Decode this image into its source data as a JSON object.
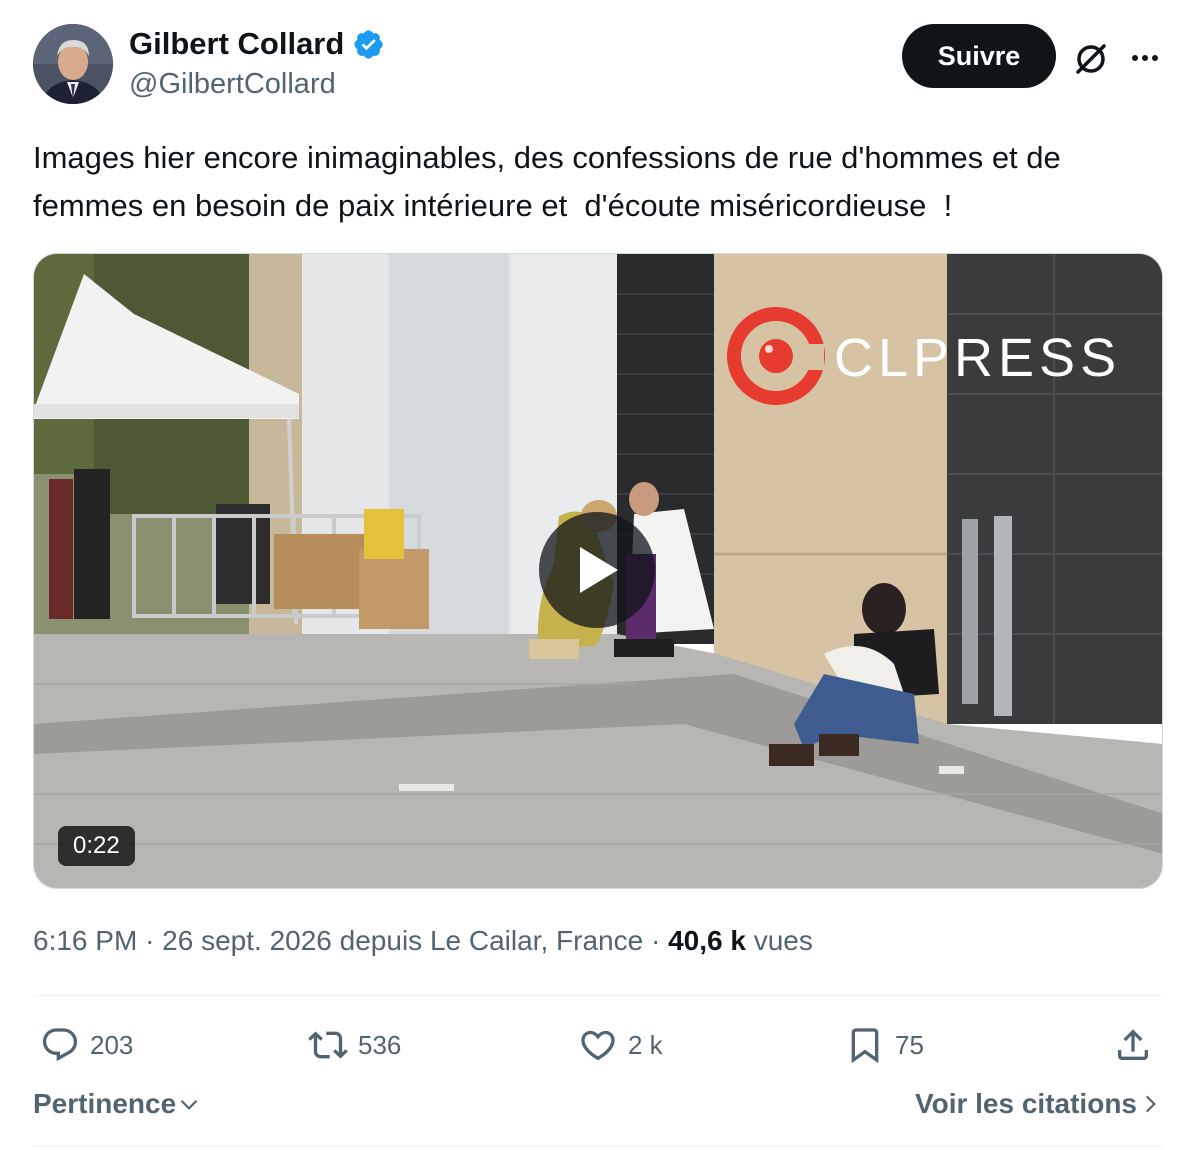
{
  "author": {
    "name": "Gilbert Collard",
    "handle": "@GilbertCollard",
    "verified": true
  },
  "header": {
    "follow_label": "Suivre",
    "icons": [
      "grok-icon",
      "more-icon"
    ]
  },
  "tweet": {
    "text": "Images hier encore inimaginables, des confessions de rue d'hommes et de femmes en besoin de paix intérieure et  d'écoute miséricordieuse  !"
  },
  "media": {
    "type": "video",
    "duration": "0:22",
    "watermark": "CLPRESS"
  },
  "meta": {
    "time": "6:16 PM",
    "separator": "·",
    "date": "26 sept. 2026",
    "location": "depuis Le Cailar, France",
    "views_count": "40,6 k",
    "views_label": "vues"
  },
  "actions": {
    "replies": "203",
    "reposts": "536",
    "likes": "2 k",
    "bookmarks": "75"
  },
  "footer": {
    "sort_label": "Pertinence",
    "quotes_label": "Voir les citations"
  },
  "colors": {
    "text": "#0f1419",
    "secondary": "#536471",
    "verified": "#1d9bf0",
    "border": "#cfd9de",
    "watermark_red": "#e63b2e"
  }
}
